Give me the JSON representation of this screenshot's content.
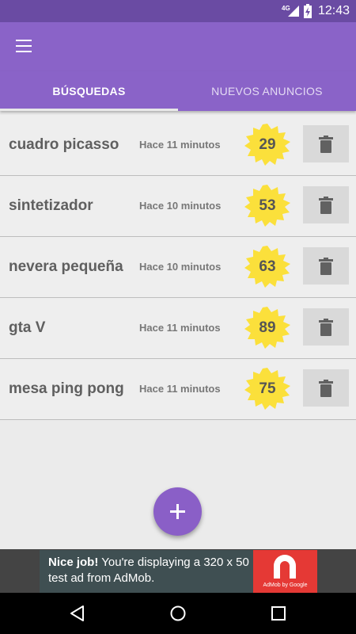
{
  "status_bar": {
    "network": "4G",
    "time": "12:43"
  },
  "app_bar": {
    "menu_icon": "hamburger-menu-icon"
  },
  "tabs": [
    {
      "label": "BÚSQUEDAS",
      "active": true
    },
    {
      "label": "NUEVOS ANUNCIOS",
      "active": false
    }
  ],
  "searches": [
    {
      "term": "cuadro picasso",
      "time": "Hace 11 minutos",
      "count": "29"
    },
    {
      "term": "sintetizador",
      "time": "Hace 10 minutos",
      "count": "53"
    },
    {
      "term": "nevera pequeña",
      "time": "Hace 10 minutos",
      "count": "63"
    },
    {
      "term": "gta V",
      "time": "Hace 11 minutos",
      "count": "89"
    },
    {
      "term": "mesa ping pong",
      "time": "Hace 11 minutos",
      "count": "75"
    }
  ],
  "fab": {
    "icon": "plus-icon"
  },
  "ad": {
    "headline": "Nice job!",
    "body": "You're displaying a 320 x 50 test ad from AdMob.",
    "logo_caption": "AdMob by Google"
  },
  "nav_bar": {
    "icons": [
      "back-icon",
      "home-icon",
      "recents-icon"
    ]
  },
  "colors": {
    "status_bar": "#6a4ba3",
    "primary": "#8a63c8",
    "badge": "#fbe03b",
    "fab": "#8a5fc7",
    "ad_logo": "#e53935"
  }
}
